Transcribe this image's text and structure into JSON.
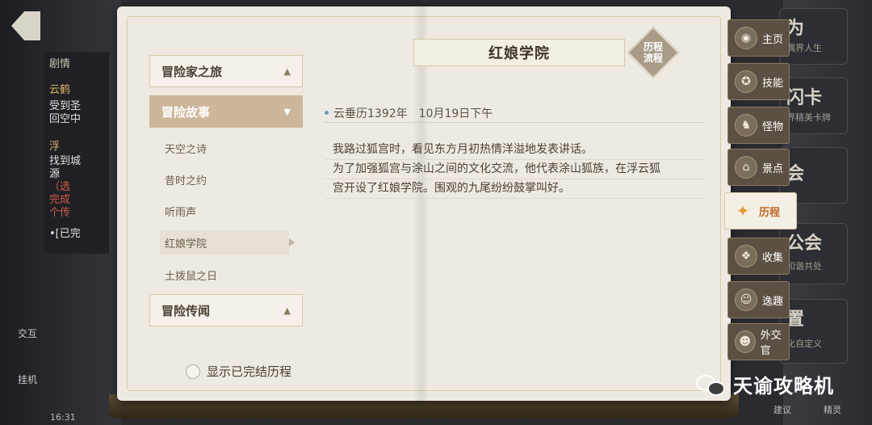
{
  "back": {
    "icon": "back-arrow-icon"
  },
  "background": {
    "chat_lines": [
      {
        "text": "剧情",
        "color": "#c9c3b4"
      },
      {
        "text": "云鹤",
        "color": "#d9b36a"
      },
      {
        "text": "受到圣",
        "color": "#e0e0e0"
      },
      {
        "text": "回空中",
        "color": "#e0e0e0"
      },
      {
        "text": "浮",
        "color": "#d9b36a"
      },
      {
        "text": "找到城",
        "color": "#e0e0e0"
      },
      {
        "text": "源",
        "color": "#e0e0e0"
      },
      {
        "text": "（选",
        "color": "#d25a4a"
      },
      {
        "text": "完成",
        "color": "#d25a4a"
      },
      {
        "text": "个传",
        "color": "#d25a4a"
      },
      {
        "text": "•[已完",
        "color": "#e0e0e0"
      }
    ],
    "left_labels": {
      "interact": "交互",
      "hangup": "挂机",
      "time": "16:31"
    },
    "right_panels": [
      {
        "title": "为",
        "sub": "偶界人生"
      },
      {
        "title": "闪卡",
        "sub": "界精美卡牌"
      },
      {
        "title": "会",
        "sub": ""
      },
      {
        "title": "公会",
        "sub": "和谐共处"
      },
      {
        "title": "置",
        "sub": "化自定义"
      }
    ],
    "bottom_right_labels": [
      "建议",
      "精灵"
    ]
  },
  "sidebar": {
    "categories": [
      {
        "label": "冒险家之旅",
        "chevron": "chevron-up-icon",
        "active": false
      },
      {
        "label": "冒险故事",
        "chevron": "chevron-down-icon",
        "active": true
      },
      {
        "label": "冒险传闻",
        "chevron": "chevron-up-icon",
        "active": false
      }
    ],
    "stories": [
      {
        "label": "天空之诗",
        "active": false
      },
      {
        "label": "昔时之约",
        "active": false
      },
      {
        "label": "听雨声",
        "active": false
      },
      {
        "label": "红娘学院",
        "active": true
      },
      {
        "label": "土拨鼠之日",
        "active": false
      }
    ],
    "show_completed_label": "显示已完结历程"
  },
  "main": {
    "title": "红娘学院",
    "badge": [
      "历程",
      "流程"
    ],
    "date": "云垂历1392年　10月19日下午",
    "story_lines": [
      "我路过狐宫时，看见东方月初热情洋溢地发表讲话。",
      "为了加强狐宫与涂山之间的文化交流，他代表涂山狐族，在浮云狐",
      "宫开设了红娘学院。围观的九尾纷纷鼓掌叫好。"
    ]
  },
  "tabs": [
    {
      "label": "主页",
      "icon": "home-icon",
      "glyph": "◉",
      "active": false
    },
    {
      "label": "技能",
      "icon": "skill-icon",
      "glyph": "✪",
      "active": false
    },
    {
      "label": "怪物",
      "icon": "monster-icon",
      "glyph": "♞",
      "active": false
    },
    {
      "label": "景点",
      "icon": "landmark-icon",
      "glyph": "⌂",
      "active": false
    },
    {
      "label": "历程",
      "icon": "journey-icon",
      "glyph": "✦",
      "active": true
    },
    {
      "label": "收集",
      "icon": "collection-icon",
      "glyph": "❖",
      "active": false
    },
    {
      "label": "逸趣",
      "icon": "fun-icon",
      "glyph": "☺",
      "active": false
    },
    {
      "label": "外交官",
      "icon": "diplomat-icon",
      "glyph": "☻",
      "active": false
    }
  ],
  "watermark": {
    "text": "天谕攻略机",
    "icon": "wechat-icon"
  }
}
